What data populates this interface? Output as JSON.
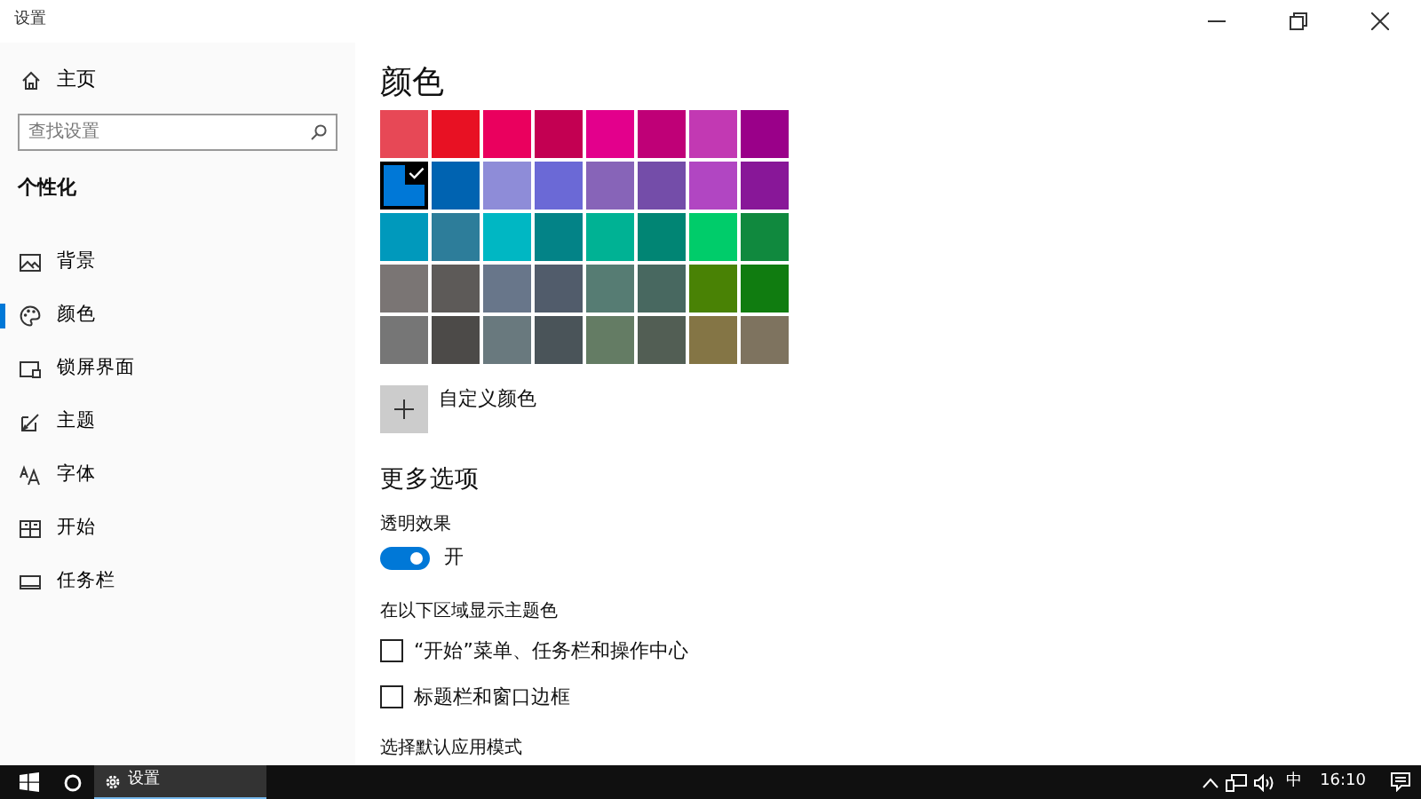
{
  "window": {
    "title": "设置"
  },
  "sidebar": {
    "home": "主页",
    "search": {
      "placeholder": "查找设置"
    },
    "section": "个性化",
    "items": [
      {
        "label": "背景",
        "selected": false
      },
      {
        "label": "颜色",
        "selected": true
      },
      {
        "label": "锁屏界面",
        "selected": false
      },
      {
        "label": "主题",
        "selected": false
      },
      {
        "label": "字体",
        "selected": false
      },
      {
        "label": "开始",
        "selected": false
      },
      {
        "label": "任务栏",
        "selected": false
      }
    ]
  },
  "heading": "颜色",
  "swatches": [
    {
      "color": "#e74856",
      "selected": false
    },
    {
      "color": "#e81123",
      "selected": false
    },
    {
      "color": "#ea005e",
      "selected": false
    },
    {
      "color": "#c30052",
      "selected": false
    },
    {
      "color": "#e3008c",
      "selected": false
    },
    {
      "color": "#bf0077",
      "selected": false
    },
    {
      "color": "#c239b3",
      "selected": false
    },
    {
      "color": "#9a0089",
      "selected": false
    },
    {
      "color": "#0078d7",
      "selected": true
    },
    {
      "color": "#0063b1",
      "selected": false
    },
    {
      "color": "#8e8cd8",
      "selected": false
    },
    {
      "color": "#6b69d6",
      "selected": false
    },
    {
      "color": "#8764b8",
      "selected": false
    },
    {
      "color": "#744da9",
      "selected": false
    },
    {
      "color": "#b146c2",
      "selected": false
    },
    {
      "color": "#881798",
      "selected": false
    },
    {
      "color": "#0099bc",
      "selected": false
    },
    {
      "color": "#2d7d9a",
      "selected": false
    },
    {
      "color": "#00b7c3",
      "selected": false
    },
    {
      "color": "#038387",
      "selected": false
    },
    {
      "color": "#00b294",
      "selected": false
    },
    {
      "color": "#018574",
      "selected": false
    },
    {
      "color": "#00cc6a",
      "selected": false
    },
    {
      "color": "#10893e",
      "selected": false
    },
    {
      "color": "#7a7574",
      "selected": false
    },
    {
      "color": "#5d5a58",
      "selected": false
    },
    {
      "color": "#68768a",
      "selected": false
    },
    {
      "color": "#515c6b",
      "selected": false
    },
    {
      "color": "#567c73",
      "selected": false
    },
    {
      "color": "#486860",
      "selected": false
    },
    {
      "color": "#498205",
      "selected": false
    },
    {
      "color": "#107c10",
      "selected": false
    },
    {
      "color": "#767676",
      "selected": false
    },
    {
      "color": "#4c4a48",
      "selected": false
    },
    {
      "color": "#69797e",
      "selected": false
    },
    {
      "color": "#4a5459",
      "selected": false
    },
    {
      "color": "#647c64",
      "selected": false
    },
    {
      "color": "#525e54",
      "selected": false
    },
    {
      "color": "#847545",
      "selected": false
    },
    {
      "color": "#7e735f",
      "selected": false
    }
  ],
  "custom_color": {
    "label": "自定义颜色"
  },
  "more_options": {
    "title": "更多选项",
    "transparency": {
      "label": "透明效果",
      "on": true,
      "state_label": "开"
    },
    "accent_surfaces": {
      "label": "在以下区域显示主题色",
      "options": [
        {
          "label": "“开始”菜单、任务栏和操作中心",
          "checked": false
        },
        {
          "label": "标题栏和窗口边框",
          "checked": false
        }
      ]
    },
    "app_mode": {
      "label": "选择默认应用模式"
    }
  },
  "taskbar": {
    "app": {
      "label": "设置",
      "active": true
    },
    "ime": "中",
    "time": "16:10"
  }
}
